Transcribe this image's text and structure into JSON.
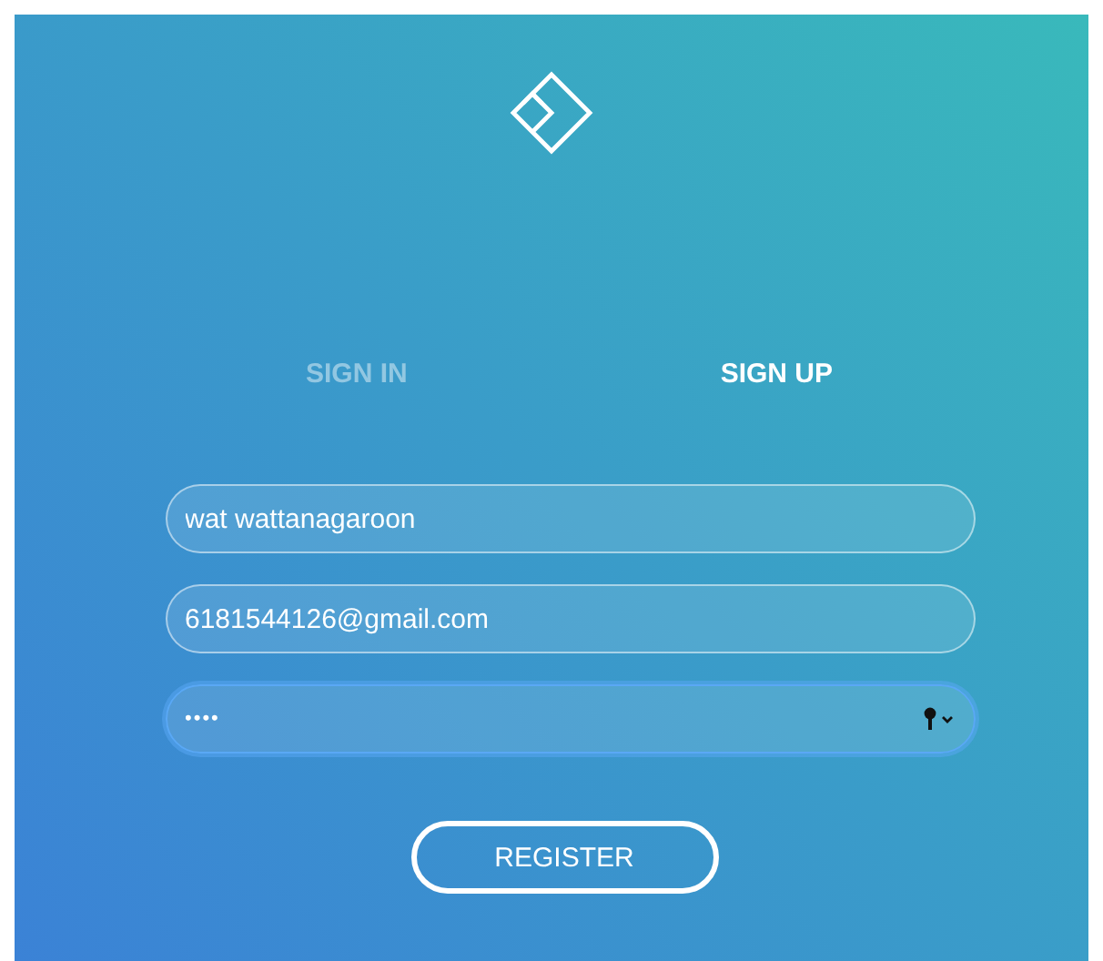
{
  "tabs": [
    {
      "label": "SIGN IN",
      "selected": false
    },
    {
      "label": "SIGN UP",
      "selected": true
    }
  ],
  "fields": [
    {
      "kind": "text",
      "value": "wat wattanagaroon",
      "focused": false
    },
    {
      "kind": "text",
      "value": "6181544126@gmail.com",
      "focused": false
    },
    {
      "kind": "password",
      "value": "••••",
      "focused": true
    }
  ],
  "button": {
    "label": "REGISTER"
  }
}
